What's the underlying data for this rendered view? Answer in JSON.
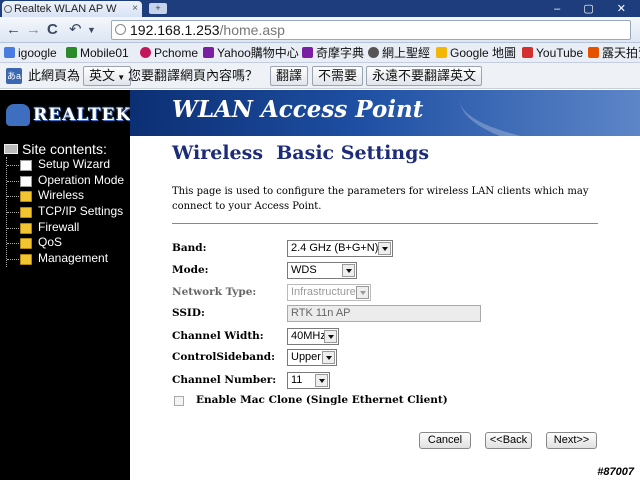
{
  "browser": {
    "tab_title": "Realtek WLAN AP W",
    "tab_close": "×",
    "new_tab": "+",
    "window_controls": "– ▢ ✕",
    "nav": {
      "back": "←",
      "forward": "→",
      "reload": "C",
      "undo": "↶"
    },
    "url_host": "192.168.1.253",
    "url_path": "/home.asp",
    "bookmarks": [
      {
        "label": "igoogle",
        "icon": "google-icon",
        "color": "#4a7be0"
      },
      {
        "label": "Mobile01",
        "icon": "mobile01-icon",
        "color": "#2a8a2a"
      },
      {
        "label": "Pchome",
        "icon": "pchome-icon",
        "color": "#c2185b"
      },
      {
        "label": "Yahoo購物中心",
        "icon": "yahoo-icon",
        "color": "#7b1fa2"
      },
      {
        "label": "奇摩字典",
        "icon": "yahoo-dict-icon",
        "color": "#7b1fa2"
      },
      {
        "label": "網上聖經",
        "icon": "bible-icon",
        "color": "#555555"
      },
      {
        "label": "Google 地圖",
        "icon": "google-maps-icon",
        "color": "#f2b705"
      },
      {
        "label": "YouTube",
        "icon": "youtube-icon",
        "color": "#d32f2f"
      },
      {
        "label": "露天拍賣",
        "icon": "ruten-icon",
        "color": "#e65100"
      }
    ],
    "translate": {
      "icon_text": "あa",
      "prompt_prefix": "此網頁為",
      "language": "英文",
      "question": "您要翻譯網頁內容嗎？",
      "translate_btn": "翻譯",
      "no_btn": "不需要",
      "never_btn": "永遠不要翻譯英文"
    }
  },
  "page": {
    "logo_text": "REALTEK",
    "banner_title": "WLAN Access Point",
    "sidebar": {
      "header": "Site contents:",
      "items": [
        {
          "label": "Setup Wizard",
          "type": "doc"
        },
        {
          "label": "Operation Mode",
          "type": "doc"
        },
        {
          "label": "Wireless",
          "type": "folder"
        },
        {
          "label": "TCP/IP Settings",
          "type": "folder"
        },
        {
          "label": "Firewall",
          "type": "folder"
        },
        {
          "label": "QoS",
          "type": "folder"
        },
        {
          "label": "Management",
          "type": "folder"
        }
      ]
    },
    "main": {
      "title": "Wireless  Basic Settings",
      "description": "This page is used to configure the parameters for wireless LAN clients which may connect to your Access Point.",
      "fields": {
        "band": {
          "label": "Band:",
          "value": "2.4 GHz (B+G+N)"
        },
        "mode": {
          "label": "Mode:",
          "value": "WDS"
        },
        "network_type": {
          "label": "Network Type:",
          "value": "Infrastructure"
        },
        "ssid": {
          "label": "SSID:",
          "value": "RTK 11n AP"
        },
        "channel_width": {
          "label": "Channel Width:",
          "value": "40MHz"
        },
        "control_sideband": {
          "label": "ControlSideband:",
          "value": "Upper"
        },
        "channel_number": {
          "label": "Channel Number:",
          "value": "11"
        }
      },
      "mac_clone": {
        "label": "Enable Mac Clone (Single Ethernet Client)",
        "checked": false
      },
      "buttons": {
        "cancel": "Cancel",
        "back": "<<Back",
        "next": "Next>>"
      }
    },
    "watermark": "#87007"
  }
}
